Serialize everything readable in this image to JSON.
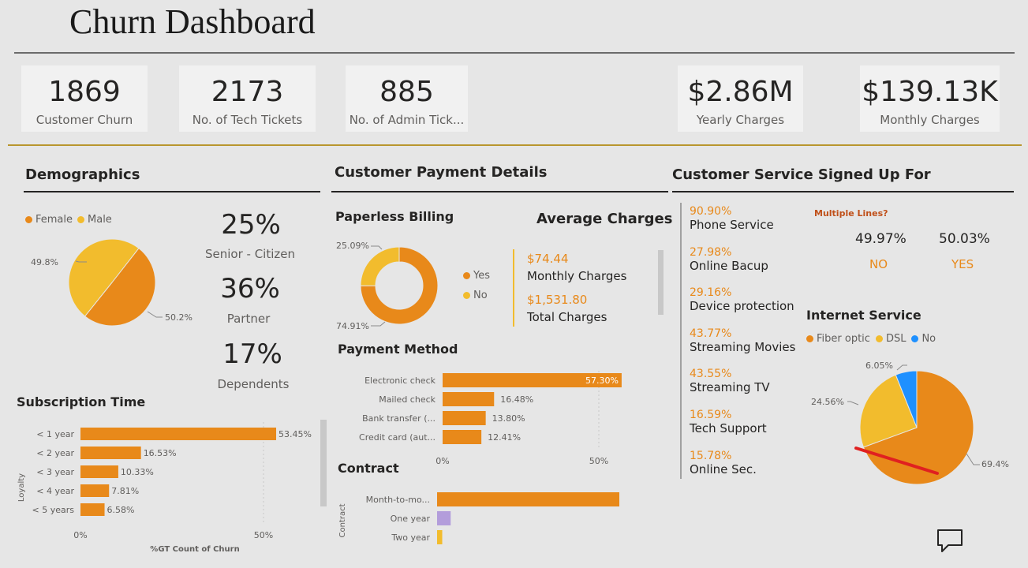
{
  "title": "Churn Dashboard",
  "kpis": {
    "churn": {
      "value": "1869",
      "label": "Customer Churn"
    },
    "tech": {
      "value": "2173",
      "label": "No. of Tech Tickets"
    },
    "admin": {
      "value": "885",
      "label": "No. of Admin Tick..."
    },
    "yearly": {
      "value": "$2.86M",
      "label": "Yearly Charges"
    },
    "monthly": {
      "value": "$139.13K",
      "label": "Monthly Charges"
    }
  },
  "demographics": {
    "title": "Demographics",
    "legend": {
      "female": "Female",
      "male": "Male"
    },
    "pie_labels": {
      "male": "49.8%",
      "female": "50.2%"
    },
    "senior": {
      "value": "25%",
      "label": "Senior - Citizen"
    },
    "partner": {
      "value": "36%",
      "label": "Partner"
    },
    "dependents": {
      "value": "17%",
      "label": "Dependents"
    }
  },
  "subscription": {
    "title": "Subscription Time",
    "yaxis": "Loyalty",
    "xaxis": "%GT Count of Churn",
    "ticks": [
      "0%",
      "50%"
    ]
  },
  "payment": {
    "title": "Customer Payment Details",
    "paperless_title": "Paperless Billing",
    "paperless_labels": {
      "no": "25.09%",
      "yes": "74.91%"
    },
    "paperless_legend": {
      "yes": "Yes",
      "no": "No"
    },
    "avg_title": "Average Charges",
    "avg_monthly": {
      "value": "$74.44",
      "label": "Monthly Charges"
    },
    "avg_total": {
      "value": "$1,531.80",
      "label": "Total Charges"
    },
    "method_title": "Payment Method",
    "method_ticks": [
      "0%",
      "50%"
    ],
    "contract_title": "Contract",
    "contract_yaxis": "Contract"
  },
  "services": {
    "title": "Customer Service Signed Up For",
    "items": [
      {
        "value": "90.90%",
        "label": "Phone Service"
      },
      {
        "value": "27.98%",
        "label": "Online Bacup"
      },
      {
        "value": "29.16%",
        "label": "Device protection"
      },
      {
        "value": "43.77%",
        "label": "Streaming Movies"
      },
      {
        "value": "43.55%",
        "label": "Streaming TV"
      },
      {
        "value": "16.59%",
        "label": "Tech Support"
      },
      {
        "value": "15.78%",
        "label": "Online Sec."
      }
    ],
    "multiple_lines": {
      "title": "Multiple Lines?",
      "no_value": "49.97%",
      "no_label": "NO",
      "yes_value": "50.03%",
      "yes_label": "YES"
    },
    "internet_title": "Internet Service",
    "internet_legend": {
      "fiber": "Fiber optic",
      "dsl": "DSL",
      "no": "No"
    },
    "internet_labels": {
      "no": "6.05%",
      "dsl": "24.56%",
      "fiber": "69.4%"
    }
  },
  "colors": {
    "orange": "#E8891A",
    "yellow": "#F2BC2D",
    "blue": "#1E90FF",
    "purple": "#B39DDB",
    "gold_line": "#B8962E"
  },
  "icons": {
    "comment": "comment-icon"
  },
  "chart_data": [
    {
      "type": "pie",
      "title": "",
      "categories": [
        "Female",
        "Male"
      ],
      "values": [
        50.2,
        49.8
      ]
    },
    {
      "type": "bar",
      "title": "Subscription Time",
      "ylabel": "Loyalty",
      "xlabel": "%GT Count of Churn",
      "categories": [
        "< 1 year",
        "< 2 year",
        "< 3 year",
        "< 4 year",
        "< 5 years"
      ],
      "values": [
        53.45,
        16.53,
        10.33,
        7.81,
        6.58
      ],
      "labels": [
        "53.45%",
        "16.53%",
        "10.33%",
        "7.81%",
        "6.58%"
      ],
      "xlim": [
        0,
        55
      ]
    },
    {
      "type": "pie",
      "title": "Paperless Billing",
      "categories": [
        "Yes",
        "No"
      ],
      "values": [
        74.91,
        25.09
      ]
    },
    {
      "type": "bar",
      "title": "Payment Method",
      "categories": [
        "Electronic check",
        "Mailed check",
        "Bank transfer (...",
        "Credit card (aut..."
      ],
      "values": [
        57.3,
        16.48,
        13.8,
        12.41
      ],
      "labels": [
        "57.30%",
        "16.48%",
        "13.80%",
        "12.41%"
      ],
      "xlim": [
        0,
        60
      ]
    },
    {
      "type": "bar",
      "title": "Contract",
      "ylabel": "Contract",
      "categories": [
        "Month-to-mo...",
        "One year",
        "Two year"
      ],
      "values": [
        88.5,
        6.6,
        2.5
      ]
    },
    {
      "type": "pie",
      "title": "Internet Service",
      "categories": [
        "Fiber optic",
        "DSL",
        "No"
      ],
      "values": [
        69.4,
        24.56,
        6.05
      ]
    }
  ]
}
